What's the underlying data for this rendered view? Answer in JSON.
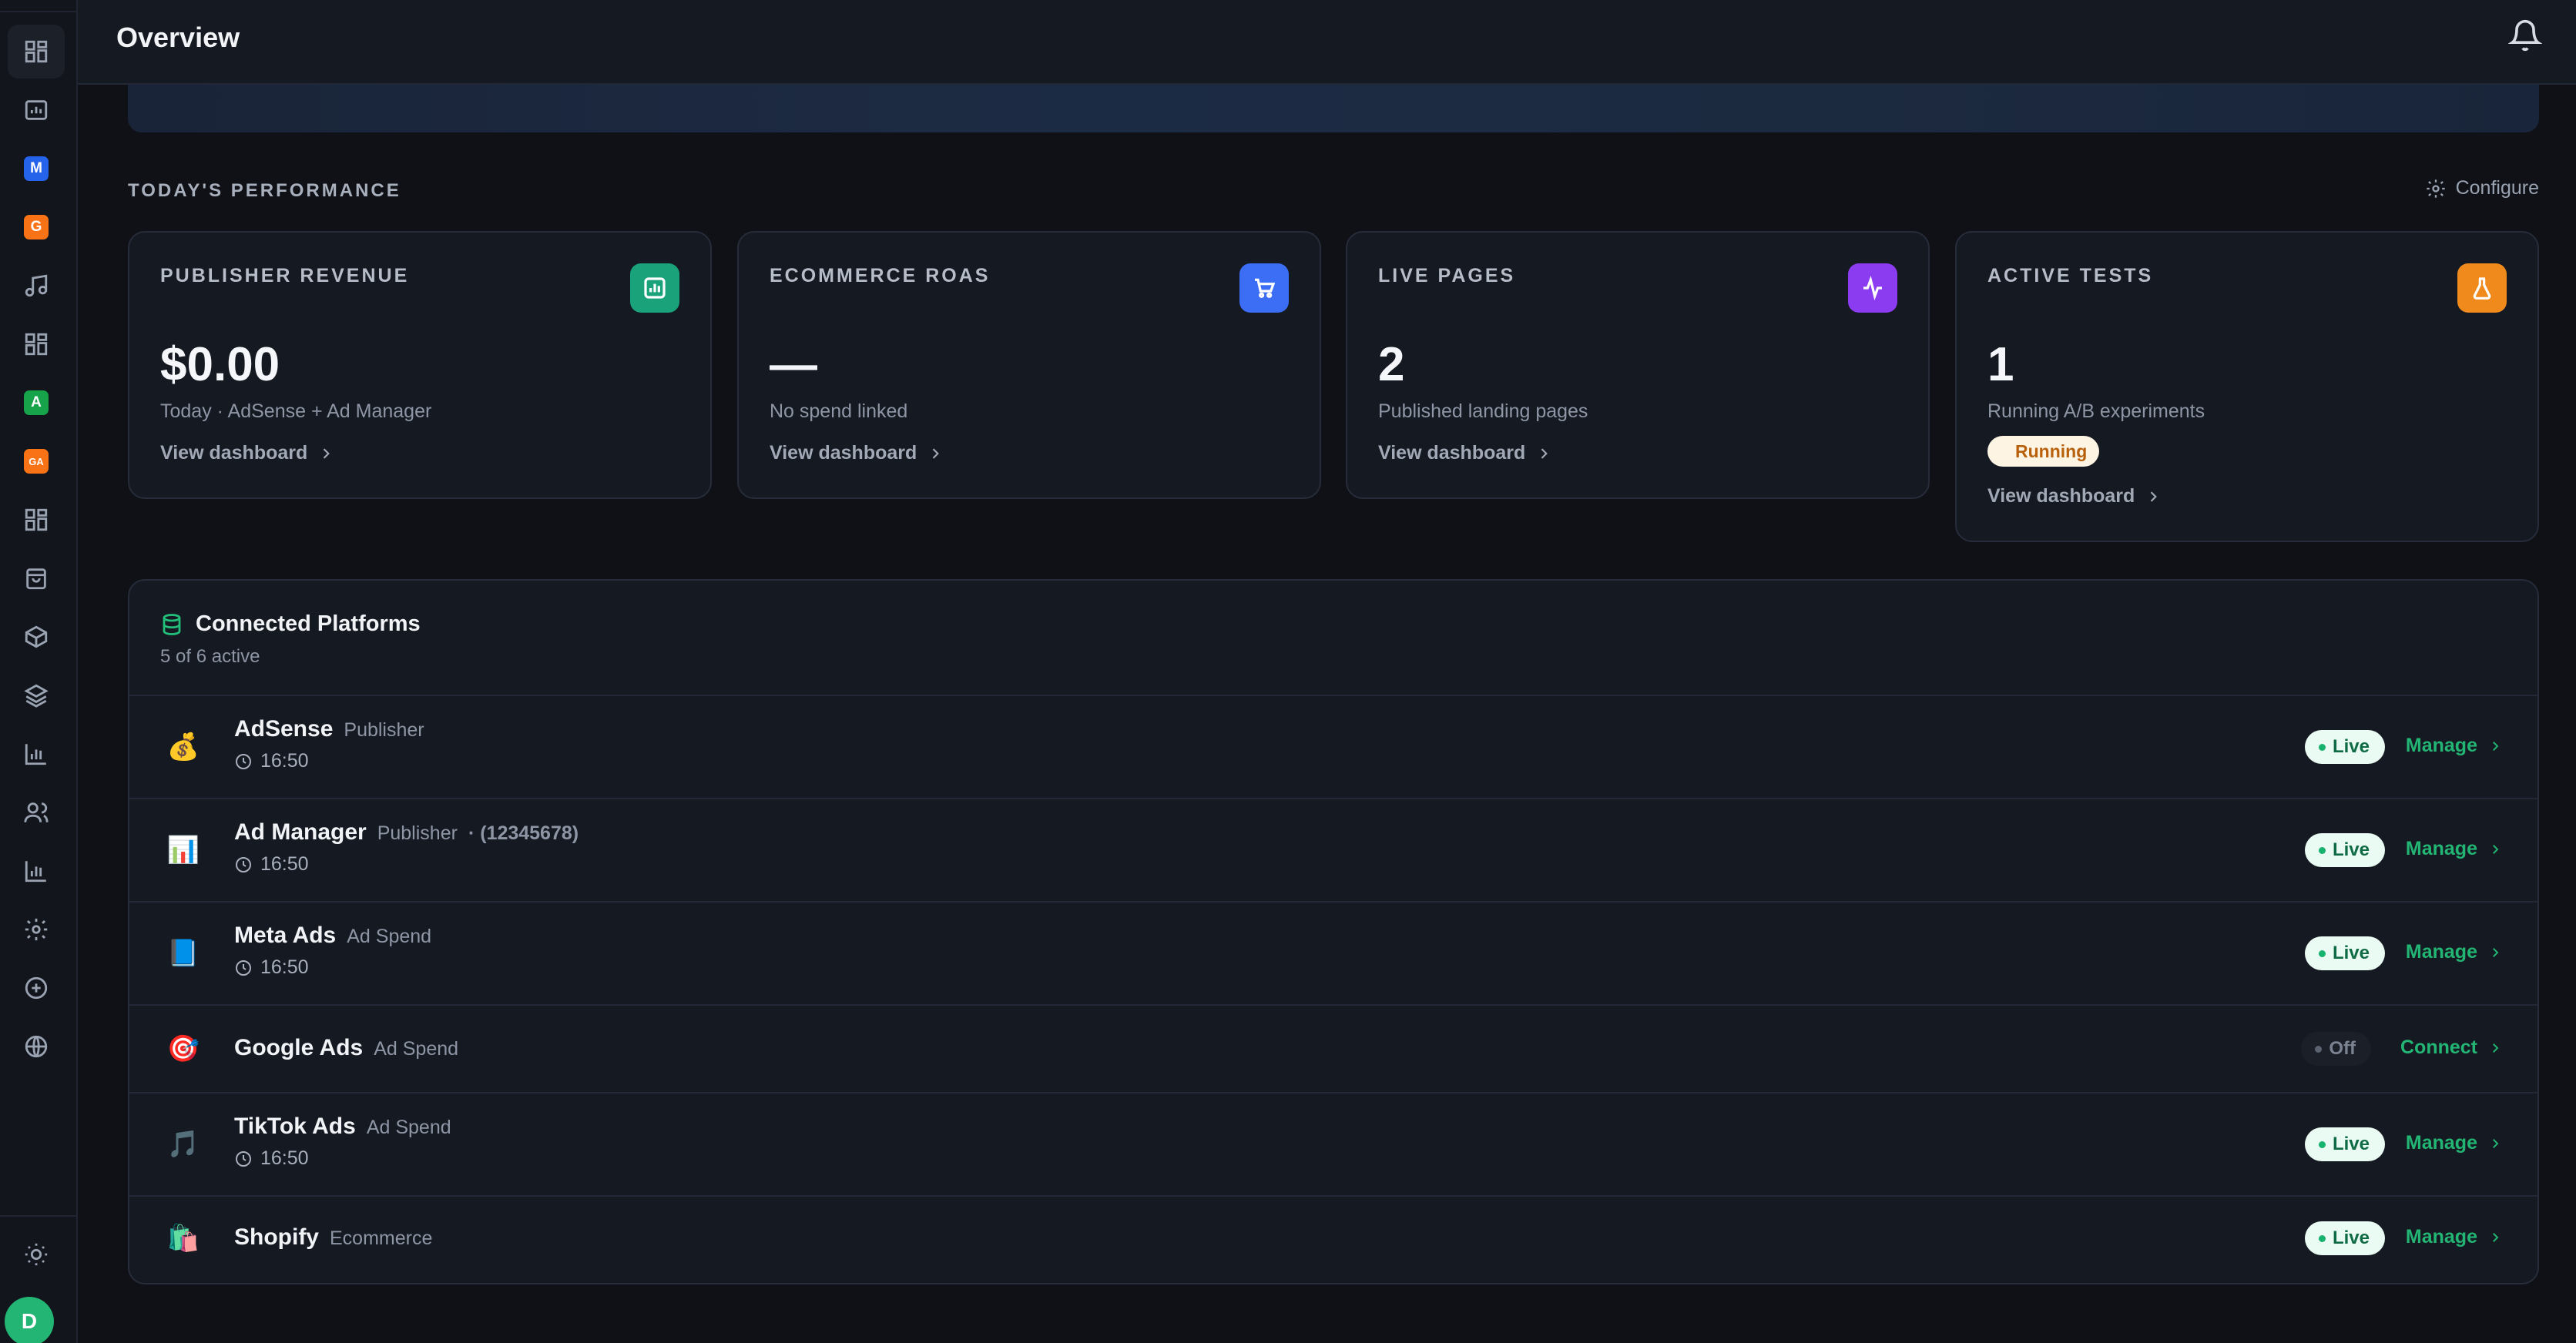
{
  "header": {
    "title": "Overview"
  },
  "sidebar": {
    "badges": [
      {
        "letter": "M",
        "color": "#2563eb"
      },
      {
        "letter": "G",
        "color": "#f97316"
      },
      {
        "letter": "A",
        "color": "#16a34a"
      },
      {
        "letter": "GA",
        "color": "#f97316"
      }
    ],
    "user_initial": "D"
  },
  "performance": {
    "title": "TODAY'S PERFORMANCE",
    "configure_label": "Configure",
    "cards": [
      {
        "label": "PUBLISHER REVENUE",
        "value": "$0.00",
        "sub": "Today · AdSense + Ad Manager",
        "link": "View dashboard",
        "icon": "bar-chart-icon",
        "icon_color": "#1aa37a"
      },
      {
        "label": "ECOMMERCE ROAS",
        "value": "—",
        "sub": "No spend linked",
        "link": "View dashboard",
        "icon": "cart-icon",
        "icon_color": "#3b6ef5"
      },
      {
        "label": "LIVE PAGES",
        "value": "2",
        "sub": "Published landing pages",
        "link": "View dashboard",
        "icon": "activity-icon",
        "icon_color": "#8b3cf0"
      },
      {
        "label": "ACTIVE TESTS",
        "value": "1",
        "sub": "Running A/B experiments",
        "badge": "Running",
        "link": "View dashboard",
        "icon": "flask-icon",
        "icon_color": "#f08a1c"
      }
    ]
  },
  "platforms": {
    "title": "Connected Platforms",
    "subtitle": "5 of 6 active",
    "rows": [
      {
        "icon": "💰",
        "name": "AdSense",
        "type": "Publisher",
        "extra": "",
        "time": "16:50",
        "status": "Live",
        "action": "Manage"
      },
      {
        "icon": "📊",
        "name": "Ad Manager",
        "type": "Publisher",
        "extra": "· (12345678)",
        "time": "16:50",
        "status": "Live",
        "action": "Manage"
      },
      {
        "icon": "📘",
        "name": "Meta Ads",
        "type": "Ad Spend",
        "extra": "",
        "time": "16:50",
        "status": "Live",
        "action": "Manage"
      },
      {
        "icon": "🎯",
        "name": "Google Ads",
        "type": "Ad Spend",
        "extra": "",
        "time": "",
        "status": "Off",
        "action": "Connect"
      },
      {
        "icon": "🎵",
        "name": "TikTok Ads",
        "type": "Ad Spend",
        "extra": "",
        "time": "16:50",
        "status": "Live",
        "action": "Manage"
      },
      {
        "icon": "🛍️",
        "name": "Shopify",
        "type": "Ecommerce",
        "extra": "",
        "time": "",
        "status": "Live",
        "action": "Manage"
      }
    ]
  }
}
